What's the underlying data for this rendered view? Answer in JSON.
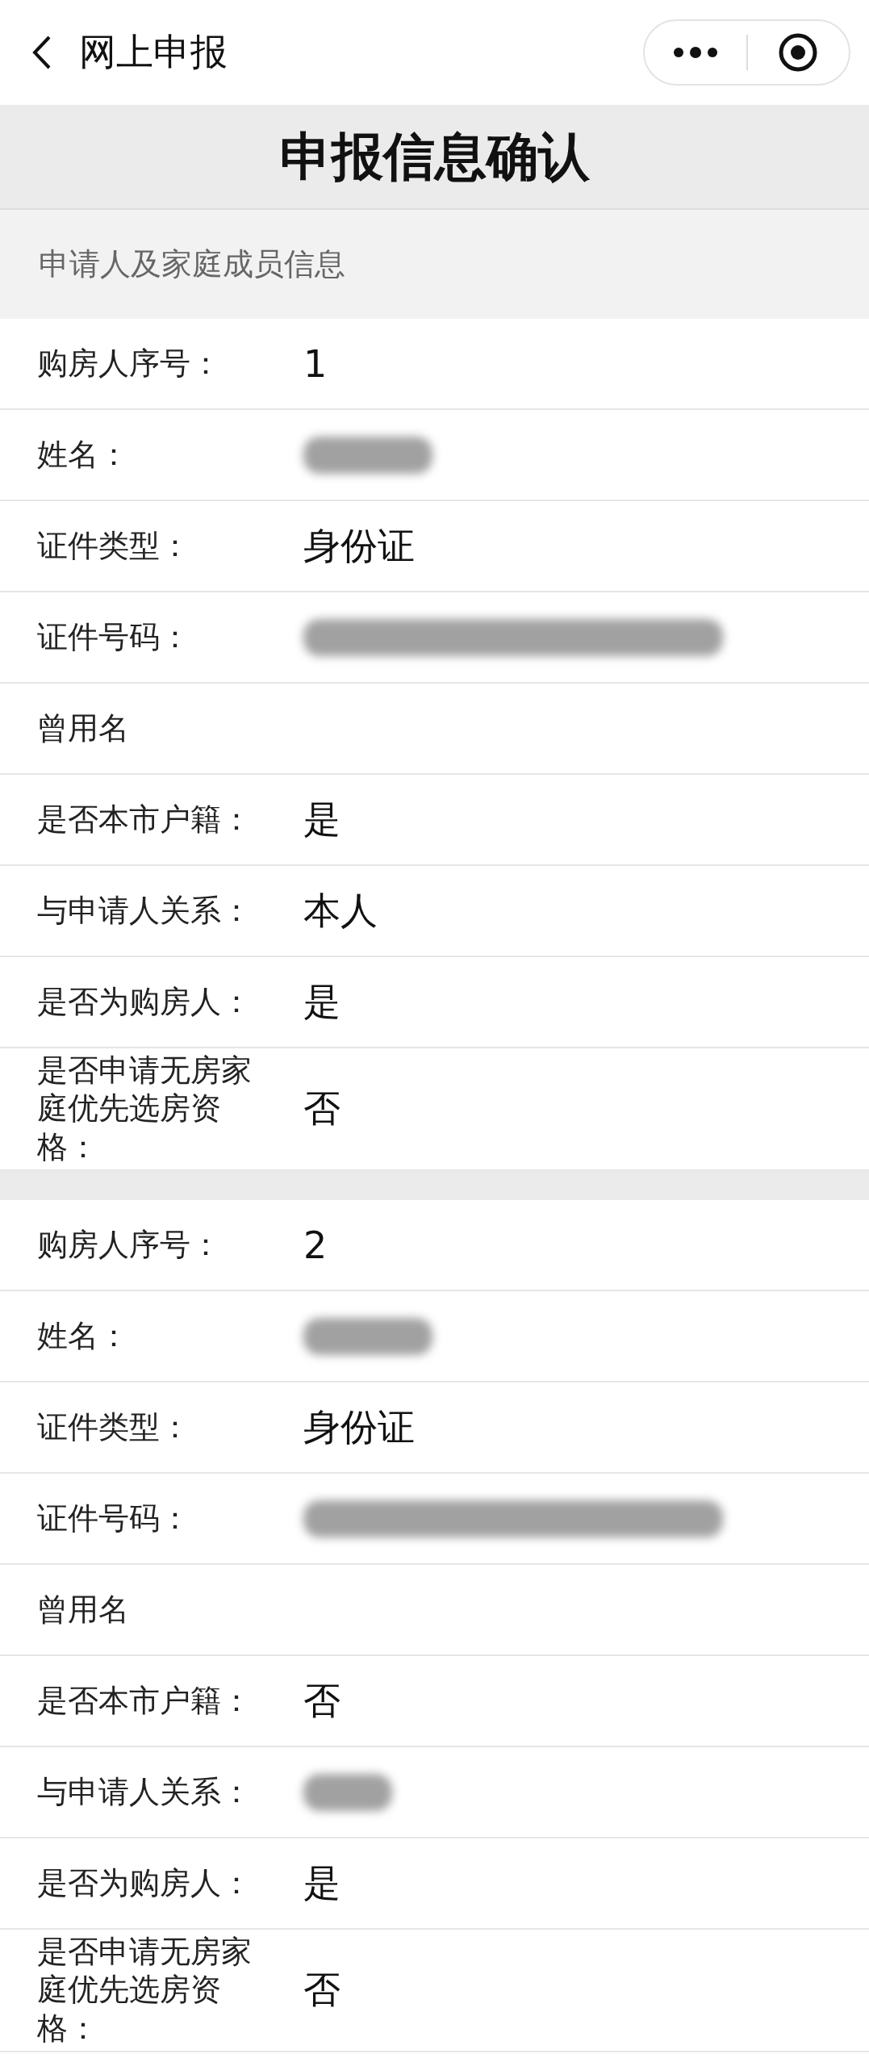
{
  "nav": {
    "title": "网上申报"
  },
  "page_title": "申报信息确认",
  "section_title": "申请人及家庭成员信息",
  "groups": [
    {
      "rows": [
        {
          "label": "购房人序号：",
          "kind": "text",
          "value": "1"
        },
        {
          "label": "姓名：",
          "kind": "redacted"
        },
        {
          "label": "证件类型：",
          "kind": "text",
          "value": "身份证"
        },
        {
          "label": "证件号码：",
          "kind": "redactedlong"
        },
        {
          "label": "曾用名",
          "kind": "empty"
        },
        {
          "label": "是否本市户籍：",
          "kind": "text",
          "value": "是"
        },
        {
          "label": "与申请人关系：",
          "kind": "text",
          "value": "本人"
        },
        {
          "label": "是否为购房人：",
          "kind": "text",
          "value": "是"
        },
        {
          "label": "是否申请无房家庭优先选房资格：",
          "kind": "text",
          "value": "否"
        }
      ]
    },
    {
      "rows": [
        {
          "label": "购房人序号：",
          "kind": "text",
          "value": "2"
        },
        {
          "label": "姓名：",
          "kind": "redacted"
        },
        {
          "label": "证件类型：",
          "kind": "text",
          "value": "身份证"
        },
        {
          "label": "证件号码：",
          "kind": "redactedlong"
        },
        {
          "label": "曾用名",
          "kind": "empty"
        },
        {
          "label": "是否本市户籍：",
          "kind": "text",
          "value": "否"
        },
        {
          "label": "与申请人关系：",
          "kind": "redactedtiny"
        },
        {
          "label": "是否为购房人：",
          "kind": "text",
          "value": "是"
        },
        {
          "label": "是否申请无房家庭优先选房资格：",
          "kind": "text",
          "value": "否"
        }
      ]
    }
  ]
}
